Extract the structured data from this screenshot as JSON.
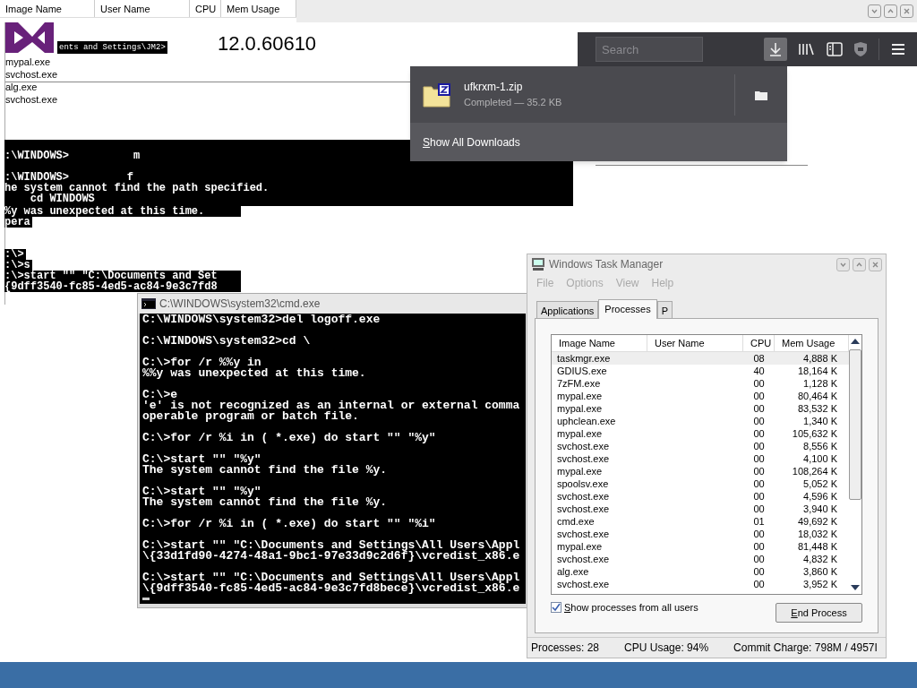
{
  "ghost_header": {
    "columns": [
      "Image Name",
      "User Name",
      "CPU",
      "Mem Usage"
    ]
  },
  "ghost_banner": {
    "console_fragment": "ents and Settings\\JM2>",
    "version": "12.0.60610"
  },
  "ghost_list": [
    "mypal.exe",
    "svchost.exe",
    "alg.exe",
    "svchost.exe"
  ],
  "ghost_console": {
    "wide_lines": [
      ":\\WINDOWS>          m",
      ":\\WINDOWS>         f",
      "he system cannot find the path specified.",
      "    cd WINDOWS"
    ],
    "narrow_blocks": [
      [
        "%y was unexpected at this time.",
        "pera"
      ],
      [
        ":\\>",
        ":\\>s",
        ":\\>start \"\" \"C:\\Documents and Set",
        "{9dff3540-fc85-4ed5-ac84-9e3c7fd8"
      ]
    ]
  },
  "browser": {
    "search": {
      "placeholder": "Search"
    },
    "downloads_active": true,
    "downloads_panel": {
      "items": [
        {
          "name": "ufkrxm-1.zip",
          "status": "Completed — 35.2 KB"
        }
      ],
      "footer": "Show All Downloads"
    }
  },
  "cmd_window": {
    "title": "C:\\WINDOWS\\system32\\cmd.exe",
    "blocks": [
      [
        "C:\\WINDOWS\\system32>del logoff.exe"
      ],
      [
        "C:\\WINDOWS\\system32>cd \\"
      ],
      [
        "C:\\>for /r %%y in",
        "%%y was unexpected at this time."
      ],
      [
        "C:\\>e",
        "'e' is not recognized as an internal or external comma",
        "operable program or batch file."
      ],
      [
        "C:\\>for /r %i in ( *.exe) do start \"\" \"%y\""
      ],
      [
        "C:\\>start \"\" \"%y\"",
        "The system cannot find the file %y."
      ],
      [
        "C:\\>start \"\" \"%y\"",
        "The system cannot find the file %y."
      ],
      [
        "C:\\>for /r %i in ( *.exe) do start \"\" \"%i\""
      ],
      [
        "C:\\>start \"\" \"C:\\Documents and Settings\\All Users\\Appl",
        "\\{33d1fd90-4274-48a1-9bc1-97e33d9c2d6f}\\vcredist_x86.e"
      ],
      [
        "C:\\>start \"\" \"C:\\Documents and Settings\\All Users\\Appl",
        "\\{9dff3540-fc85-4ed5-ac84-9e3c7fd8bece}\\vcredist_x86.e"
      ]
    ]
  },
  "task_manager": {
    "title": "Windows Task Manager",
    "menu": [
      "File",
      "Options",
      "View",
      "Help"
    ],
    "tabs": [
      {
        "label": "Applications",
        "selected": false
      },
      {
        "label": "Processes",
        "selected": true
      },
      {
        "label": "P",
        "selected": false
      }
    ],
    "table": {
      "columns": [
        "Image Name",
        "User Name",
        "CPU",
        "Mem Usage"
      ],
      "rows": [
        {
          "image": "taskmgr.exe",
          "cpu": "08",
          "mem": "4,888 K",
          "selected": true
        },
        {
          "image": "GDIUS.exe",
          "cpu": "40",
          "mem": "18,164 K",
          "selected": false
        },
        {
          "image": "7zFM.exe",
          "cpu": "00",
          "mem": "1,128 K",
          "selected": false
        },
        {
          "image": "mypal.exe",
          "cpu": "00",
          "mem": "80,464 K",
          "selected": false
        },
        {
          "image": "mypal.exe",
          "cpu": "00",
          "mem": "83,532 K",
          "selected": false
        },
        {
          "image": "uphclean.exe",
          "cpu": "00",
          "mem": "1,340 K",
          "selected": false
        },
        {
          "image": "mypal.exe",
          "cpu": "00",
          "mem": "105,632 K",
          "selected": false
        },
        {
          "image": "svchost.exe",
          "cpu": "00",
          "mem": "8,556 K",
          "selected": false
        },
        {
          "image": "svchost.exe",
          "cpu": "00",
          "mem": "4,100 K",
          "selected": false
        },
        {
          "image": "mypal.exe",
          "cpu": "00",
          "mem": "108,264 K",
          "selected": false
        },
        {
          "image": "spoolsv.exe",
          "cpu": "00",
          "mem": "5,052 K",
          "selected": false
        },
        {
          "image": "svchost.exe",
          "cpu": "00",
          "mem": "4,596 K",
          "selected": false
        },
        {
          "image": "svchost.exe",
          "cpu": "00",
          "mem": "3,940 K",
          "selected": false
        },
        {
          "image": "cmd.exe",
          "cpu": "01",
          "mem": "49,692 K",
          "selected": false
        },
        {
          "image": "svchost.exe",
          "cpu": "00",
          "mem": "18,032 K",
          "selected": false
        },
        {
          "image": "mypal.exe",
          "cpu": "00",
          "mem": "81,448 K",
          "selected": false
        },
        {
          "image": "svchost.exe",
          "cpu": "00",
          "mem": "4,832 K",
          "selected": false
        },
        {
          "image": "alg.exe",
          "cpu": "00",
          "mem": "3,860 K",
          "selected": false
        },
        {
          "image": "svchost.exe",
          "cpu": "00",
          "mem": "3,952 K",
          "selected": false
        }
      ]
    },
    "show_all_users": {
      "label": "Show processes from all users",
      "checked": true
    },
    "end_button": "End Process",
    "status": [
      "Processes: 28",
      "CPU Usage: 94%",
      "Commit Charge: 798M / 4957I"
    ]
  }
}
